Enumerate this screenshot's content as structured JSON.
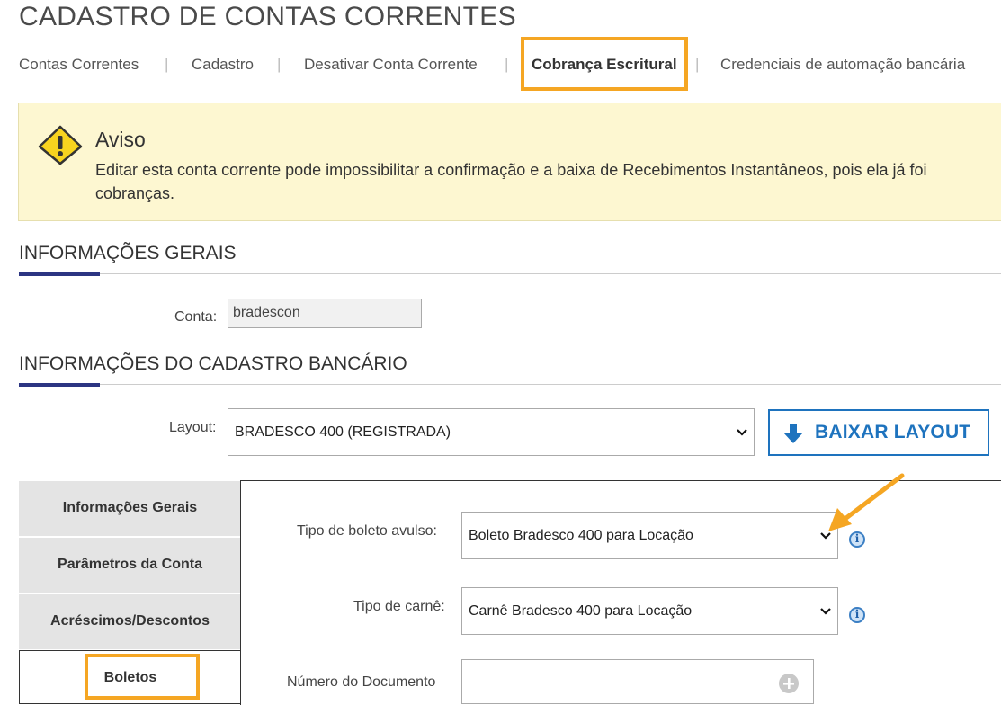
{
  "page": {
    "title": "CADASTRO DE CONTAS CORRENTES"
  },
  "tabs": [
    {
      "label": "Contas Correntes"
    },
    {
      "label": "Cadastro"
    },
    {
      "label": "Desativar Conta Corrente"
    },
    {
      "label": "Cobrança Escritural",
      "active": true
    },
    {
      "label": "Credenciais de automação bancária"
    }
  ],
  "tab_separator": "|",
  "warning": {
    "title": "Aviso",
    "text": "Editar esta conta corrente pode impossibilitar a confirmação e a baixa de Recebimentos Instantâneos, pois ela já foi cobranças."
  },
  "general_info": {
    "title": "INFORMAÇÕES GERAIS",
    "account_label": "Conta:",
    "account_value": "bradescon"
  },
  "bank_info": {
    "title": "INFORMAÇÕES DO CADASTRO BANCÁRIO",
    "layout_label": "Layout:",
    "layout_value": "BRADESCO 400 (REGISTRADA)",
    "download_button": "BAIXAR LAYOUT"
  },
  "side_tabs": [
    {
      "label": "Informações Gerais"
    },
    {
      "label": "Parâmetros da Conta"
    },
    {
      "label": "Acréscimos/Descontos"
    },
    {
      "label": "Boletos",
      "active": true
    }
  ],
  "boletos_form": {
    "tipo_boleto_label": "Tipo de boleto avulso:",
    "tipo_boleto_value": "Boleto Bradesco 400 para Locação",
    "tipo_carne_label": "Tipo de carnê:",
    "tipo_carne_value": "Carnê Bradesco 400 para Locação",
    "numero_doc_label": "Número do Documento",
    "numero_doc_value": ""
  },
  "colors": {
    "highlight": "#f5a623",
    "accent": "#2c3582",
    "link_blue": "#1e73be",
    "warning_bg": "#fdf7d1"
  }
}
